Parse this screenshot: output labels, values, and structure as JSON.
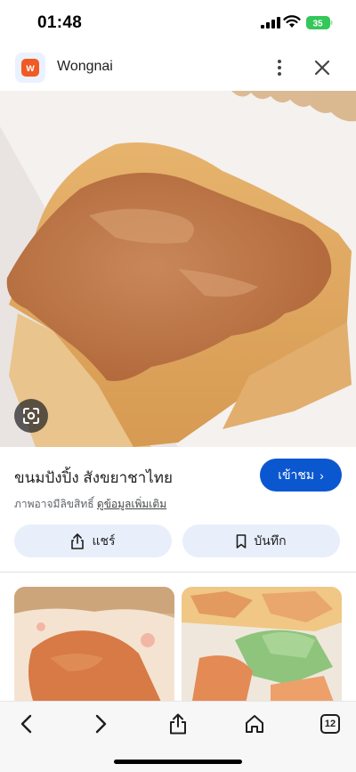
{
  "status_bar": {
    "time": "01:48",
    "battery": "35"
  },
  "header": {
    "site_name": "Wongnai",
    "logo_letter": "w",
    "logo_color": "#f15a24"
  },
  "result": {
    "title": "ขนมปังปิ้ง สังขยาชาไทย",
    "visit_label": "เข้าชม",
    "copyright_text": "ภาพอาจมีลิขสิทธิ์",
    "more_info_link": "ดูข้อมูลเพิ่มเติม",
    "share_label": "แชร์",
    "save_label": "บันทึก",
    "accent_color": "#0b57d0"
  },
  "toolbar": {
    "tab_count": "12",
    "icons": [
      "back-icon",
      "forward-icon",
      "share-icon",
      "home-icon",
      "tabs-icon"
    ]
  }
}
